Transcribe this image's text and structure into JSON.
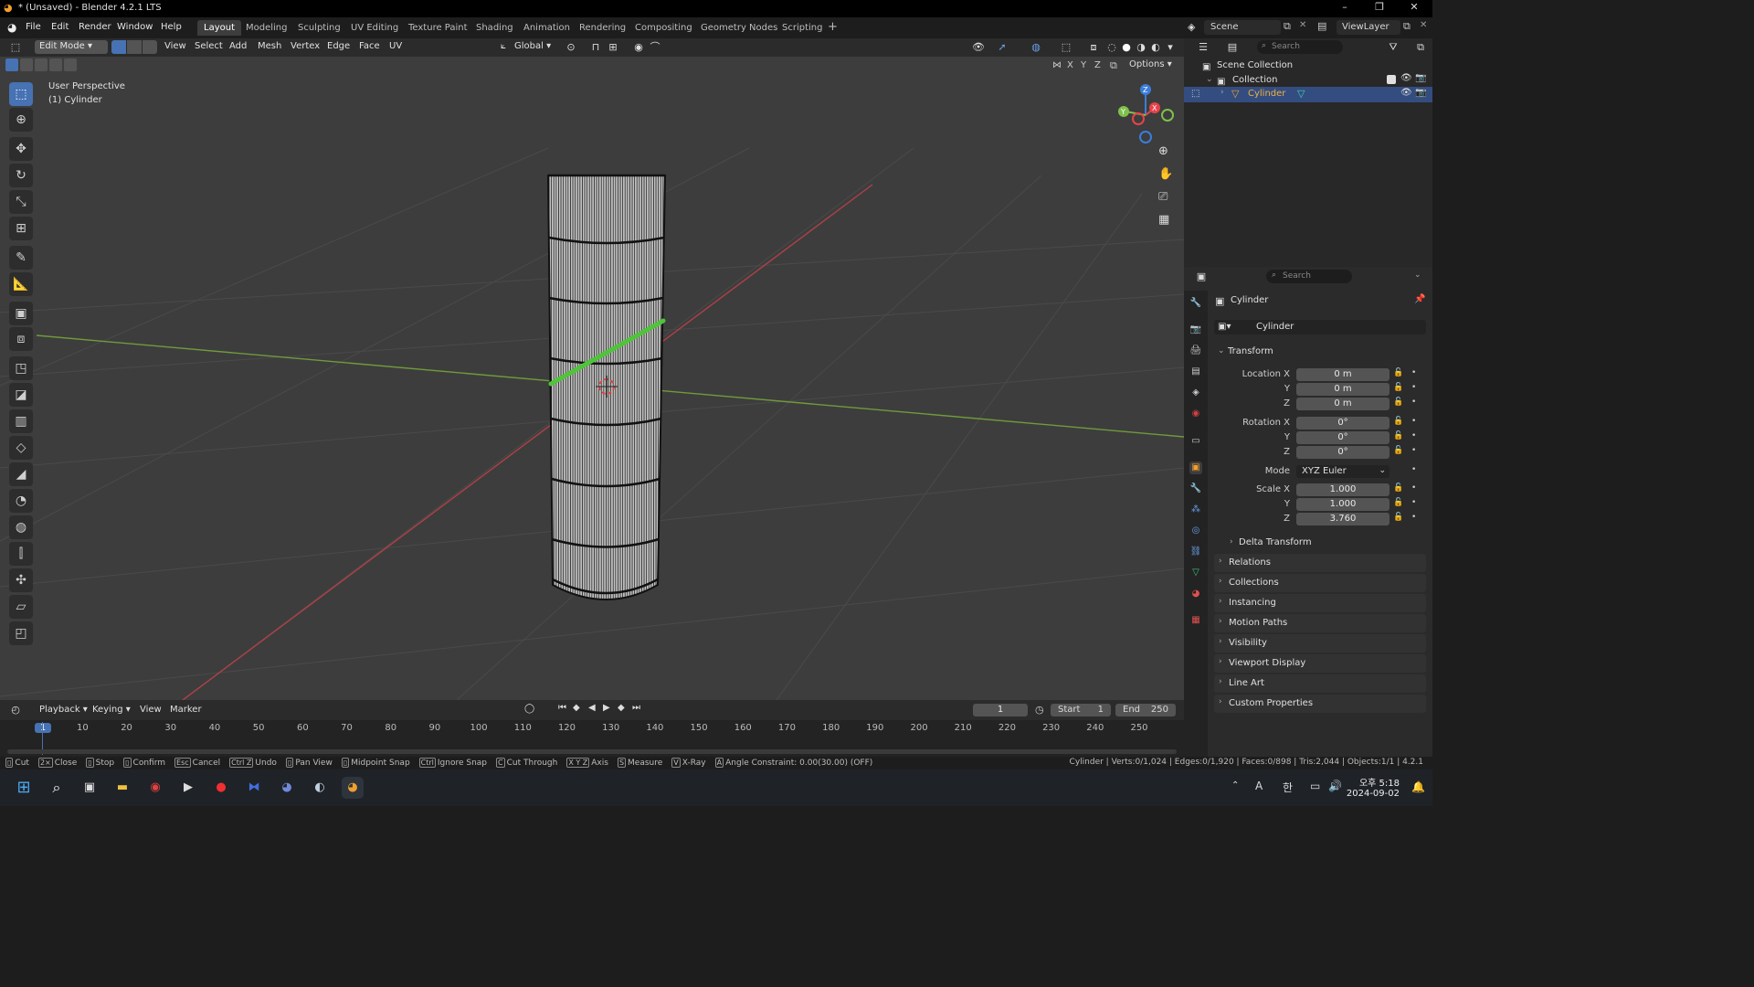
{
  "window": {
    "title": "* (Unsaved) - Blender 4.2.1 LTS",
    "controls": [
      "–",
      "❐",
      "✕"
    ]
  },
  "menu": [
    "File",
    "Edit",
    "Render",
    "Window",
    "Help"
  ],
  "workspaces": [
    "Layout",
    "Modeling",
    "Sculpting",
    "UV Editing",
    "Texture Paint",
    "Shading",
    "Animation",
    "Rendering",
    "Compositing",
    "Geometry Nodes",
    "Scripting"
  ],
  "active_workspace": "Layout",
  "scene": {
    "name": "Scene",
    "view_layer": "ViewLayer"
  },
  "viewport_header": {
    "mode": "Edit Mode",
    "menus": [
      "View",
      "Select",
      "Add",
      "Mesh",
      "Vertex",
      "Edge",
      "Face",
      "UV"
    ],
    "orientation": "Global",
    "options_label": "Options",
    "axes": [
      "X",
      "Y",
      "Z"
    ]
  },
  "viewport": {
    "perspective": "User Perspective",
    "object": "(1) Cylinder"
  },
  "gizmo": {
    "x": "X",
    "y": "Y",
    "z": "Z"
  },
  "outliner": {
    "search_placeholder": "Search",
    "scene_collection": "Scene Collection",
    "collection": "Collection",
    "object": "Cylinder"
  },
  "properties": {
    "search_placeholder": "Search",
    "object_name": "Cylinder",
    "data_name": "Cylinder",
    "transform_title": "Transform",
    "location": {
      "label": "Location X",
      "x": "0 m",
      "y": "0 m",
      "z": "0 m"
    },
    "rotation": {
      "label": "Rotation X",
      "x": "0°",
      "y": "0°",
      "z": "0°"
    },
    "mode": {
      "label": "Mode",
      "value": "XYZ Euler"
    },
    "scale": {
      "label": "Scale X",
      "x": "1.000",
      "y": "1.000",
      "z": "3.760"
    },
    "axis_y": "Y",
    "axis_z": "Z",
    "delta_transform": "Delta Transform",
    "panels": [
      "Relations",
      "Collections",
      "Instancing",
      "Motion Paths",
      "Visibility",
      "Viewport Display",
      "Line Art",
      "Custom Properties"
    ]
  },
  "timeline": {
    "menus": [
      "Playback",
      "Keying",
      "View",
      "Marker"
    ],
    "current_frame": "1",
    "start_label": "Start",
    "start": "1",
    "end_label": "End",
    "end": "250",
    "ticks": [
      "1",
      "10",
      "20",
      "30",
      "40",
      "50",
      "60",
      "70",
      "80",
      "90",
      "100",
      "110",
      "120",
      "130",
      "140",
      "150",
      "160",
      "170",
      "180",
      "190",
      "200",
      "210",
      "220",
      "230",
      "240",
      "250"
    ]
  },
  "statusbar": {
    "hints": [
      {
        "key": "",
        "label": "Cut"
      },
      {
        "key": "2×",
        "label": "Close"
      },
      {
        "key": "",
        "label": "Stop"
      },
      {
        "key": "",
        "label": "Confirm"
      },
      {
        "key": "Esc",
        "label": "Cancel"
      },
      {
        "key": "Ctrl Z",
        "label": "Undo"
      },
      {
        "key": "",
        "label": "Pan View"
      },
      {
        "key": "",
        "label": "Midpoint Snap"
      },
      {
        "key": "Ctrl",
        "label": "Ignore Snap"
      },
      {
        "key": "C",
        "label": "Cut Through"
      },
      {
        "key": "X Y Z",
        "label": "Axis"
      },
      {
        "key": "S",
        "label": "Measure"
      },
      {
        "key": "V",
        "label": "X-Ray"
      },
      {
        "key": "A",
        "label": "Angle Constraint: 0.00(30.00) (OFF)"
      }
    ],
    "stats": "Cylinder | Verts:0/1,024 | Edges:0/1,920 | Faces:0/898 | Tris:2,044 | Objects:1/1 | 4.2.1"
  },
  "taskbar": {
    "time": "오후 5:18",
    "date": "2024-09-02",
    "lang": "A",
    "ime": "한"
  },
  "colors": {
    "accent": "#4772b3",
    "x_axis": "#e8424a",
    "y_axis": "#7fc14a",
    "z_axis": "#3b7ddb",
    "selected_edge": "#4fc43a"
  }
}
